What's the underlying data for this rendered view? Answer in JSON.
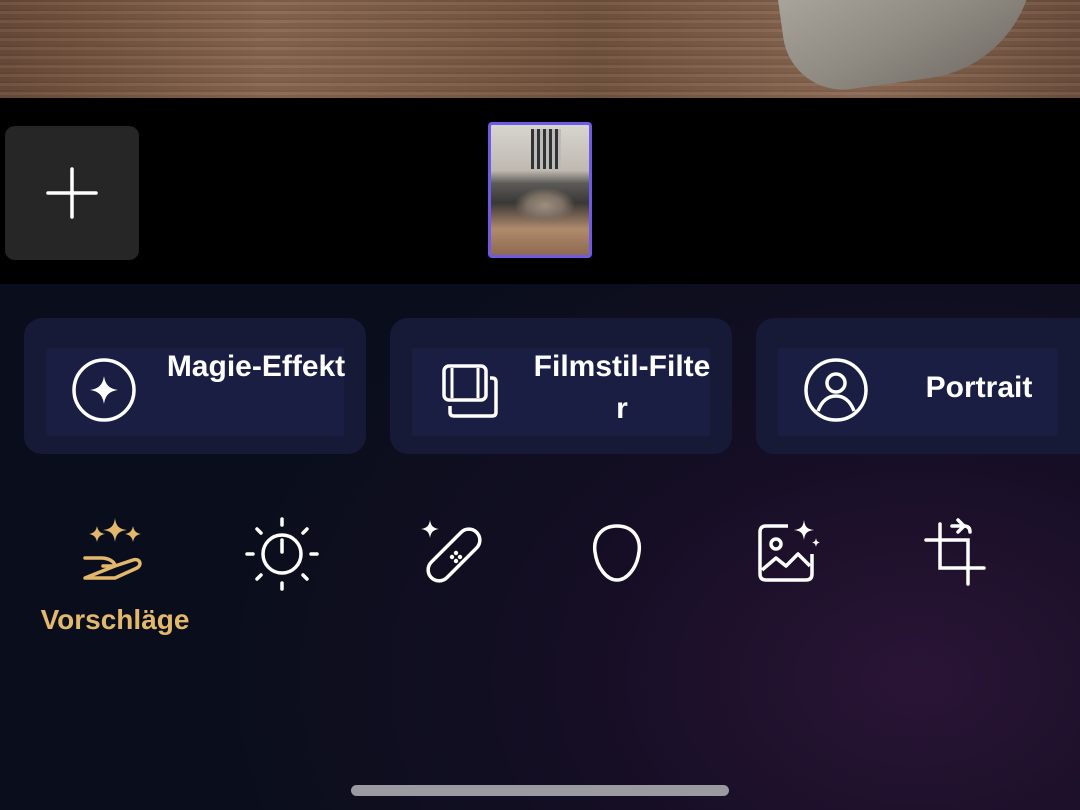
{
  "colors": {
    "accent_gold": "#e3b86c",
    "thumb_border": "#6f5ae6",
    "card_bg": "#161a36"
  },
  "thumbnails": {
    "add_icon": "plus-icon"
  },
  "cards": [
    {
      "label": "Magie-Effekt",
      "icon": "magic-effect-icon"
    },
    {
      "label": "Filmstil-Filter",
      "icon": "film-filter-icon"
    },
    {
      "label": "Portrait",
      "icon": "portrait-icon"
    }
  ],
  "tools": [
    {
      "label": "Vorschläge",
      "icon": "suggestions-hand-sparkle-icon",
      "active": true
    },
    {
      "icon": "brightness-adjust-icon"
    },
    {
      "icon": "retouch-bandage-icon"
    },
    {
      "icon": "face-icon"
    },
    {
      "icon": "ai-image-icon"
    },
    {
      "icon": "crop-rotate-icon"
    }
  ]
}
